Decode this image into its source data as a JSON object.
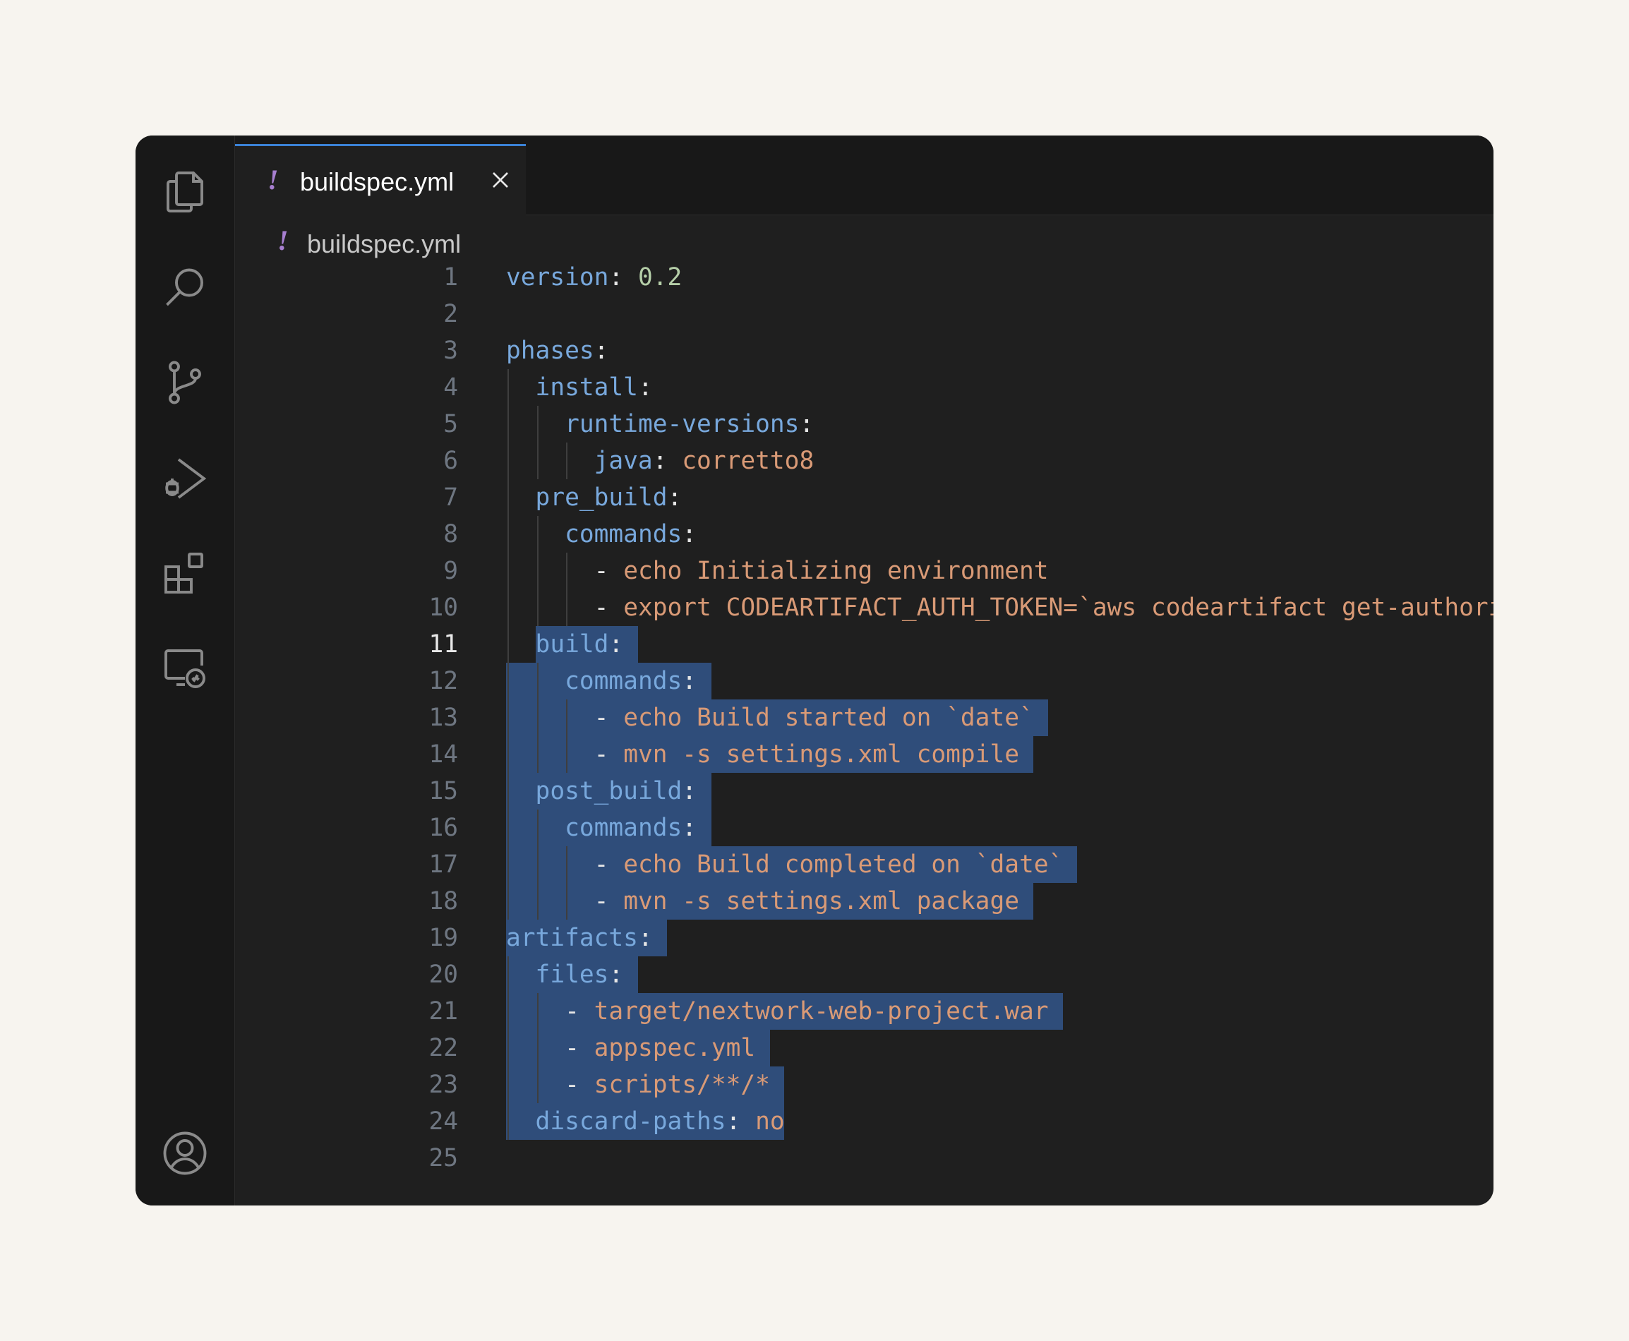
{
  "tab": {
    "label": "buildspec.yml",
    "icon": "exclamation-icon"
  },
  "breadcrumb": {
    "label": "buildspec.yml"
  },
  "colors": {
    "key": "#78a8dc",
    "string": "#d99a76",
    "number": "#b5cea8",
    "selection": "#2f4d7a",
    "yaml_icon": "#a77fd0"
  },
  "active_line": 11,
  "lines": [
    {
      "n": "1",
      "text": "version: 0.2"
    },
    {
      "n": "2",
      "text": ""
    },
    {
      "n": "3",
      "text": "phases:"
    },
    {
      "n": "4",
      "text": "  install:"
    },
    {
      "n": "5",
      "text": "    runtime-versions:"
    },
    {
      "n": "6",
      "text": "      java: corretto8"
    },
    {
      "n": "7",
      "text": "  pre_build:"
    },
    {
      "n": "8",
      "text": "    commands:"
    },
    {
      "n": "9",
      "text": "      - echo Initializing environment"
    },
    {
      "n": "10",
      "text": "      - export CODEARTIFACT_AUTH_TOKEN=`aws codeartifact get-authorization-to"
    },
    {
      "n": "11",
      "text": "  build:"
    },
    {
      "n": "12",
      "text": "    commands:"
    },
    {
      "n": "13",
      "text": "      - echo Build started on `date`"
    },
    {
      "n": "14",
      "text": "      - mvn -s settings.xml compile"
    },
    {
      "n": "15",
      "text": "  post_build:"
    },
    {
      "n": "16",
      "text": "    commands:"
    },
    {
      "n": "17",
      "text": "      - echo Build completed on `date`"
    },
    {
      "n": "18",
      "text": "      - mvn -s settings.xml package"
    },
    {
      "n": "19",
      "text": "artifacts:"
    },
    {
      "n": "20",
      "text": "  files:"
    },
    {
      "n": "21",
      "text": "    - target/nextwork-web-project.war"
    },
    {
      "n": "22",
      "text": "    - appspec.yml"
    },
    {
      "n": "23",
      "text": "    - scripts/**/*"
    },
    {
      "n": "24",
      "text": "  discard-paths: no"
    },
    {
      "n": "25",
      "text": ""
    }
  ]
}
